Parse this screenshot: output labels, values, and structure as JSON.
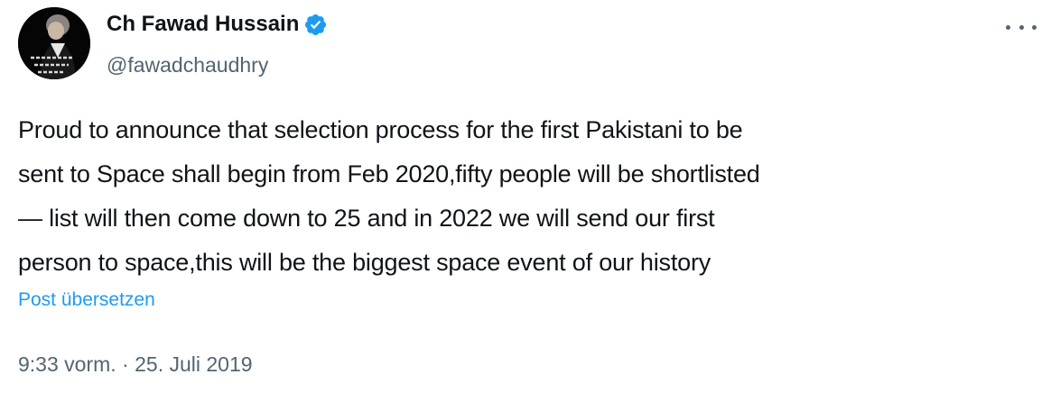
{
  "author": {
    "name": "Ch Fawad Hussain",
    "handle": "@fawadchaudhry",
    "verified": true,
    "avatar_icon": "profile-photo"
  },
  "menu": {
    "icon": "more-options-icon"
  },
  "post": {
    "text": "Proud to announce that selection process for the first Pakistani to be\nsent to Space shall begin from Feb 2020,fifty people will be shortlisted\n— list will then come down to 25 and in 2022 we will send our first\nperson to space,this will be the biggest space event of our history",
    "translate_label": "Post übersetzen",
    "time": "9:33 vorm.",
    "separator": "·",
    "date": "25. Juli 2019"
  },
  "colors": {
    "text": "#0f1419",
    "secondary": "#536471",
    "link": "#1d9bf0",
    "verified": "#1d9bf0"
  }
}
